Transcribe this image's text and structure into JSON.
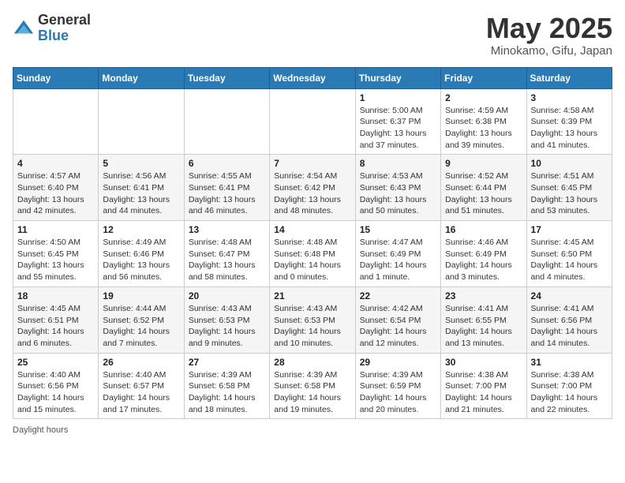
{
  "logo": {
    "general": "General",
    "blue": "Blue"
  },
  "title": "May 2025",
  "location": "Minokamo, Gifu, Japan",
  "days_of_week": [
    "Sunday",
    "Monday",
    "Tuesday",
    "Wednesday",
    "Thursday",
    "Friday",
    "Saturday"
  ],
  "footer": "Daylight hours",
  "weeks": [
    [
      {
        "day": "",
        "info": ""
      },
      {
        "day": "",
        "info": ""
      },
      {
        "day": "",
        "info": ""
      },
      {
        "day": "",
        "info": ""
      },
      {
        "day": "1",
        "info": "Sunrise: 5:00 AM\nSunset: 6:37 PM\nDaylight: 13 hours\nand 37 minutes."
      },
      {
        "day": "2",
        "info": "Sunrise: 4:59 AM\nSunset: 6:38 PM\nDaylight: 13 hours\nand 39 minutes."
      },
      {
        "day": "3",
        "info": "Sunrise: 4:58 AM\nSunset: 6:39 PM\nDaylight: 13 hours\nand 41 minutes."
      }
    ],
    [
      {
        "day": "4",
        "info": "Sunrise: 4:57 AM\nSunset: 6:40 PM\nDaylight: 13 hours\nand 42 minutes."
      },
      {
        "day": "5",
        "info": "Sunrise: 4:56 AM\nSunset: 6:41 PM\nDaylight: 13 hours\nand 44 minutes."
      },
      {
        "day": "6",
        "info": "Sunrise: 4:55 AM\nSunset: 6:41 PM\nDaylight: 13 hours\nand 46 minutes."
      },
      {
        "day": "7",
        "info": "Sunrise: 4:54 AM\nSunset: 6:42 PM\nDaylight: 13 hours\nand 48 minutes."
      },
      {
        "day": "8",
        "info": "Sunrise: 4:53 AM\nSunset: 6:43 PM\nDaylight: 13 hours\nand 50 minutes."
      },
      {
        "day": "9",
        "info": "Sunrise: 4:52 AM\nSunset: 6:44 PM\nDaylight: 13 hours\nand 51 minutes."
      },
      {
        "day": "10",
        "info": "Sunrise: 4:51 AM\nSunset: 6:45 PM\nDaylight: 13 hours\nand 53 minutes."
      }
    ],
    [
      {
        "day": "11",
        "info": "Sunrise: 4:50 AM\nSunset: 6:45 PM\nDaylight: 13 hours\nand 55 minutes."
      },
      {
        "day": "12",
        "info": "Sunrise: 4:49 AM\nSunset: 6:46 PM\nDaylight: 13 hours\nand 56 minutes."
      },
      {
        "day": "13",
        "info": "Sunrise: 4:48 AM\nSunset: 6:47 PM\nDaylight: 13 hours\nand 58 minutes."
      },
      {
        "day": "14",
        "info": "Sunrise: 4:48 AM\nSunset: 6:48 PM\nDaylight: 14 hours\nand 0 minutes."
      },
      {
        "day": "15",
        "info": "Sunrise: 4:47 AM\nSunset: 6:49 PM\nDaylight: 14 hours\nand 1 minute."
      },
      {
        "day": "16",
        "info": "Sunrise: 4:46 AM\nSunset: 6:49 PM\nDaylight: 14 hours\nand 3 minutes."
      },
      {
        "day": "17",
        "info": "Sunrise: 4:45 AM\nSunset: 6:50 PM\nDaylight: 14 hours\nand 4 minutes."
      }
    ],
    [
      {
        "day": "18",
        "info": "Sunrise: 4:45 AM\nSunset: 6:51 PM\nDaylight: 14 hours\nand 6 minutes."
      },
      {
        "day": "19",
        "info": "Sunrise: 4:44 AM\nSunset: 6:52 PM\nDaylight: 14 hours\nand 7 minutes."
      },
      {
        "day": "20",
        "info": "Sunrise: 4:43 AM\nSunset: 6:53 PM\nDaylight: 14 hours\nand 9 minutes."
      },
      {
        "day": "21",
        "info": "Sunrise: 4:43 AM\nSunset: 6:53 PM\nDaylight: 14 hours\nand 10 minutes."
      },
      {
        "day": "22",
        "info": "Sunrise: 4:42 AM\nSunset: 6:54 PM\nDaylight: 14 hours\nand 12 minutes."
      },
      {
        "day": "23",
        "info": "Sunrise: 4:41 AM\nSunset: 6:55 PM\nDaylight: 14 hours\nand 13 minutes."
      },
      {
        "day": "24",
        "info": "Sunrise: 4:41 AM\nSunset: 6:56 PM\nDaylight: 14 hours\nand 14 minutes."
      }
    ],
    [
      {
        "day": "25",
        "info": "Sunrise: 4:40 AM\nSunset: 6:56 PM\nDaylight: 14 hours\nand 15 minutes."
      },
      {
        "day": "26",
        "info": "Sunrise: 4:40 AM\nSunset: 6:57 PM\nDaylight: 14 hours\nand 17 minutes."
      },
      {
        "day": "27",
        "info": "Sunrise: 4:39 AM\nSunset: 6:58 PM\nDaylight: 14 hours\nand 18 minutes."
      },
      {
        "day": "28",
        "info": "Sunrise: 4:39 AM\nSunset: 6:58 PM\nDaylight: 14 hours\nand 19 minutes."
      },
      {
        "day": "29",
        "info": "Sunrise: 4:39 AM\nSunset: 6:59 PM\nDaylight: 14 hours\nand 20 minutes."
      },
      {
        "day": "30",
        "info": "Sunrise: 4:38 AM\nSunset: 7:00 PM\nDaylight: 14 hours\nand 21 minutes."
      },
      {
        "day": "31",
        "info": "Sunrise: 4:38 AM\nSunset: 7:00 PM\nDaylight: 14 hours\nand 22 minutes."
      }
    ]
  ]
}
